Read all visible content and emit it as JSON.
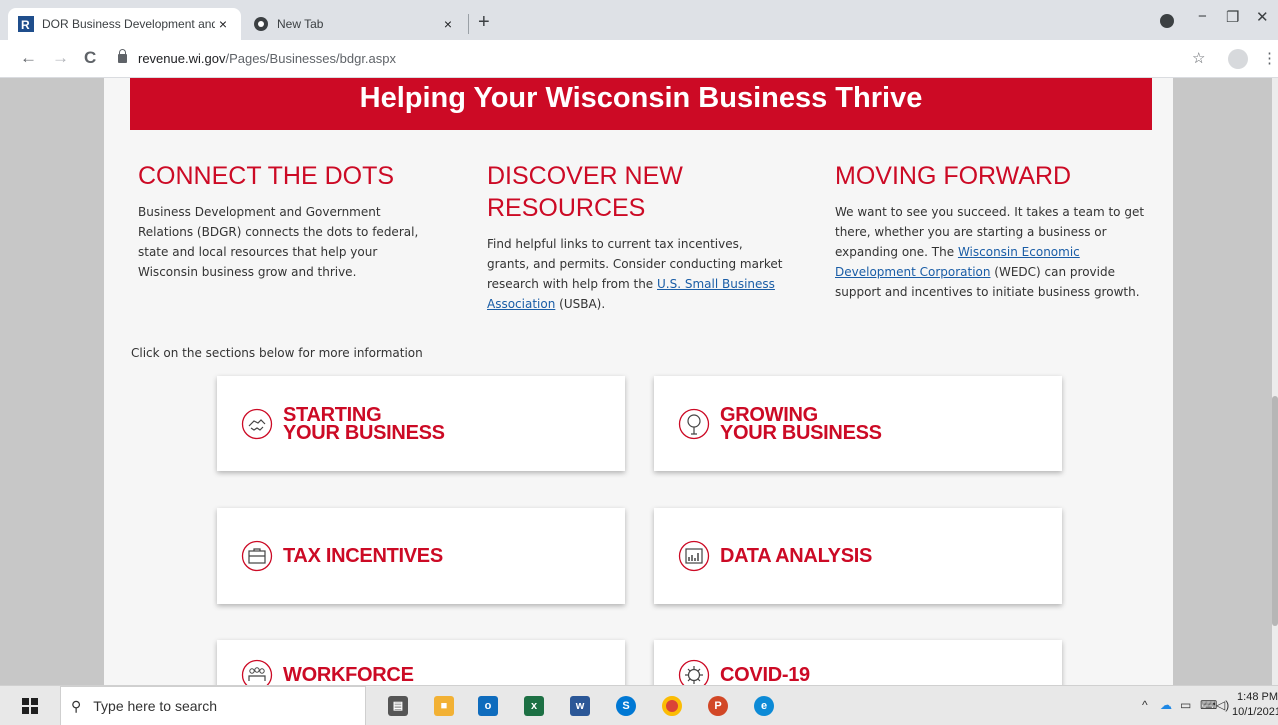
{
  "browser": {
    "tabs": [
      {
        "title": "DOR Business Development and",
        "active": true
      },
      {
        "title": "New Tab",
        "active": false
      }
    ],
    "tab_close": "×",
    "new_tab": "+",
    "url_domain": "revenue.wi.gov",
    "url_path": "/Pages/Businesses/bdgr.aspx",
    "nav": {
      "back": "←",
      "forward": "→",
      "reload": "C"
    },
    "icons": {
      "star": "☆",
      "menu": "⋮",
      "minimize": "−",
      "restore": "❐",
      "close": "✕"
    }
  },
  "page": {
    "hero_title": "Helping Your Wisconsin Business Thrive",
    "columns": [
      {
        "heading": "CONNECT THE DOTS",
        "text": "Business Development and Government Relations (BDGR) connects the dots to federal, state and local resources that help your Wisconsin business grow and thrive."
      },
      {
        "heading": "DISCOVER NEW RESOURCES",
        "text_before": "Find helpful links to current tax incentives, grants, and permits. Consider conducting market research with help from the ",
        "link": "U.S. Small Business Association",
        "text_after": " (USBA)."
      },
      {
        "heading": "MOVING FORWARD",
        "text_before": "We want to see you succeed. It takes a team to get there, whether you are starting a business or expanding one. The ",
        "link": "Wisconsin Economic Development Corporation",
        "text_after": " (WEDC) can provide support and incentives to initiate business growth."
      }
    ],
    "sections_hint": "Click on the sections below for more information",
    "cards": [
      {
        "label": "STARTING\nYOUR BUSINESS",
        "icon": "handshake-icon"
      },
      {
        "label": "GROWING\nYOUR BUSINESS",
        "icon": "tree-icon"
      },
      {
        "label": "TAX INCENTIVES",
        "icon": "briefcase-icon"
      },
      {
        "label": "DATA ANALYSIS",
        "icon": "chart-icon"
      },
      {
        "label": "WORKFORCE",
        "icon": "people-icon"
      },
      {
        "label": "COVID-19",
        "icon": "virus-icon"
      }
    ]
  },
  "taskbar": {
    "search_placeholder": "Type here to search",
    "time": "1:48 PM",
    "date": "10/1/2021"
  },
  "colors": {
    "brand_red": "#cc0a25",
    "link_blue": "#1a5da6"
  }
}
